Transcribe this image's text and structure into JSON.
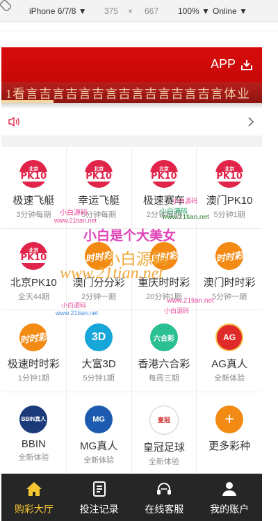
{
  "devtools": {
    "device": "iPhone 6/7/8 ▼",
    "width": "375",
    "times": "×",
    "height": "667",
    "zoom": "100% ▼",
    "network": "Online ▼"
  },
  "header": {
    "app_label": "APP"
  },
  "banner": {
    "text": "1看言吉言吉言吉言吉言吉言吉言吉言体业"
  },
  "lottery_items": [
    {
      "title": "极速飞艇",
      "sub": "3分钟每期",
      "logo": "pk10"
    },
    {
      "title": "幸运飞艇",
      "sub": "5分钟每期",
      "logo": "pk10"
    },
    {
      "title": "极速赛车",
      "sub": "2分钟每期",
      "logo": "pk10"
    },
    {
      "title": "澳门PK10",
      "sub": "5分钟1期",
      "logo": "pk10"
    },
    {
      "title": "北京PK10",
      "sub": "全天44期",
      "logo": "pk10"
    },
    {
      "title": "澳门分分彩",
      "sub": "2分钟一期",
      "logo": "ssc"
    },
    {
      "title": "重庆时时彩",
      "sub": "20分钟1期",
      "logo": "ssc"
    },
    {
      "title": "澳门时时彩",
      "sub": "5分钟一期",
      "logo": "ssc"
    },
    {
      "title": "极速时时彩",
      "sub": "1分钟1期",
      "logo": "ssc"
    },
    {
      "title": "大富3D",
      "sub": "5分钟1期",
      "logo": "3d"
    },
    {
      "title": "香港六合彩",
      "sub": "每周三期",
      "logo": "hk"
    },
    {
      "title": "AG真人",
      "sub": "全新体验",
      "logo": "ag"
    },
    {
      "title": "BBIN",
      "sub": "全新体验",
      "logo": "bbin"
    },
    {
      "title": "MG真人",
      "sub": "全新体验",
      "logo": "mg"
    },
    {
      "title": "皇冠足球",
      "sub": "全新体验",
      "logo": "hg"
    },
    {
      "title": "更多彩种",
      "sub": "",
      "logo": "more"
    }
  ],
  "logo_text": {
    "pk_top": "北京",
    "pk_main": "PK10",
    "ssc": "时时彩",
    "d3": "3D",
    "hk": "六合彩",
    "ag": "AG",
    "bbin": "BBIN真人",
    "mg": "MG",
    "hg": "皇冠",
    "more": "+"
  },
  "watermarks": {
    "w1": "小白是个大美女",
    "w2": "小白源码",
    "w3": "www.21tian.net",
    "w4": "小白源码",
    "w5": "www.21tian.net",
    "w6": "小白源码",
    "w7": "www.21tian.net",
    "w8": "www.21tian.net",
    "w9": "小白源码",
    "w10": "www.21tian.net",
    "w11": "小白源码",
    "w12": "小白源码"
  },
  "tabs": [
    {
      "label": "购彩大厅",
      "icon": "home-icon",
      "active": true
    },
    {
      "label": "投注记录",
      "icon": "record-icon",
      "active": false
    },
    {
      "label": "在线客服",
      "icon": "headset-icon",
      "active": false
    },
    {
      "label": "我的账户",
      "icon": "user-icon",
      "active": false
    }
  ],
  "colors": {
    "header_red": "#d70c0c",
    "tab_active": "#f6c631",
    "tab_bg": "#262626",
    "pk10_pink": "#e0244a",
    "ssc_orange": "#f28a14"
  }
}
